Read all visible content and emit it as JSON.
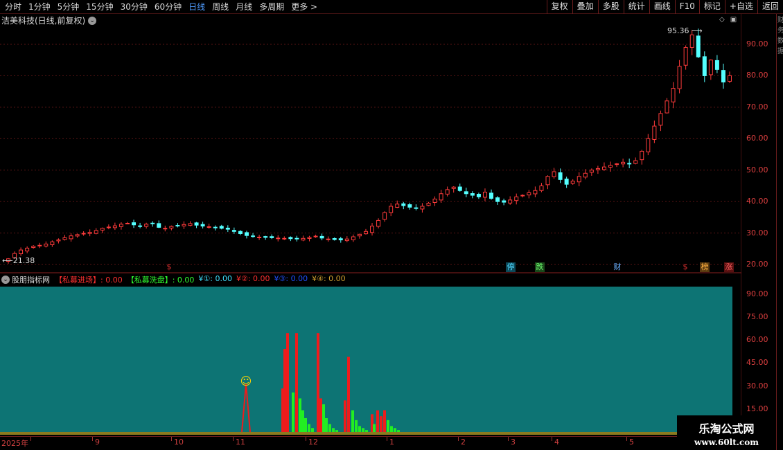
{
  "toolbar": {
    "periods": [
      "分时",
      "1分钟",
      "5分钟",
      "15分钟",
      "30分钟",
      "60分钟",
      "日线",
      "周线",
      "月线",
      "多周期",
      "更多 >"
    ],
    "active_period": "日线",
    "tools": [
      "复权",
      "叠加",
      "多股",
      "统计",
      "画线",
      "F10",
      "标记",
      "+自选",
      "返回"
    ]
  },
  "main": {
    "title": "洁美科技(日线,前复权)",
    "high_label": "95.36",
    "low_label": "21.38",
    "y_ticks": [
      "90.00",
      "80.00",
      "70.00",
      "60.00",
      "50.00",
      "40.00",
      "30.00",
      "20.00"
    ],
    "markers": [
      {
        "text": "$",
        "color": "#e03030",
        "bg": "transparent"
      },
      {
        "text": "停",
        "color": "#4fd8ff",
        "bg": "#0d4a5a"
      },
      {
        "text": "跌",
        "color": "#70ff70",
        "bg": "#1a4a1a"
      },
      {
        "text": "财",
        "color": "#6ab0ff",
        "bg": "transparent"
      },
      {
        "text": "$",
        "color": "#e03030",
        "bg": "transparent"
      },
      {
        "text": "榜",
        "color": "#ffb040",
        "bg": "#5a3a10"
      },
      {
        "text": "涨",
        "color": "#ff6060",
        "bg": "#5a1010"
      }
    ]
  },
  "indicator": {
    "name": "股朋指标网",
    "items": [
      {
        "label": "【私募进场】: 0.00",
        "color": "#ff3030"
      },
      {
        "label": "【私募洗盘】: 0.00",
        "color": "#30ff30"
      },
      {
        "label": "¥①: 0.00",
        "color": "#40e0ff"
      },
      {
        "label": "¥②: 0.00",
        "color": "#ff3030"
      },
      {
        "label": "¥③: 0.00",
        "color": "#2050ff"
      },
      {
        "label": "¥④: 0.00",
        "color": "#d0a030"
      }
    ],
    "y_ticks": [
      "90.00",
      "75.00",
      "60.00",
      "45.00",
      "30.00",
      "15.00"
    ],
    "background": "#0d7474",
    "smiley": "☺"
  },
  "timeline": {
    "labels": [
      "2025年",
      "9",
      "10",
      "11",
      "12",
      "1",
      "2",
      "3",
      "4",
      "5"
    ]
  },
  "watermark": {
    "title": "乐淘公式网",
    "url": "www.60lt.com"
  },
  "right_strip_text": "财务数据",
  "chart_data": {
    "type": "candlestick",
    "title": "洁美科技(日线,前复权)",
    "ylim": [
      18,
      100
    ],
    "y_ticks": [
      20,
      30,
      40,
      50,
      60,
      70,
      80,
      90
    ],
    "high": 95.36,
    "low": 21.38,
    "x_labels": [
      "2025年",
      "9",
      "10",
      "11",
      "12",
      "1",
      "2",
      "3",
      "4",
      "5"
    ],
    "close_values": [
      21.8,
      23.5,
      24.6,
      25.2,
      25.8,
      26.1,
      26.5,
      27.2,
      27.8,
      28.5,
      29.1,
      29.5,
      29.9,
      30.2,
      30.8,
      31.5,
      31.9,
      32.3,
      32.8,
      33.1,
      32.6,
      32.2,
      32.8,
      33.0,
      31.8,
      31.5,
      32.1,
      32.4,
      32.7,
      33.0,
      32.5,
      32.2,
      32.0,
      31.8,
      31.5,
      31.2,
      30.5,
      29.8,
      29.2,
      28.9,
      28.7,
      28.6,
      28.5,
      28.4,
      28.3,
      28.2,
      28.1,
      28.3,
      28.6,
      29.0,
      28.4,
      28.1,
      27.9,
      27.8,
      28.1,
      28.8,
      29.6,
      30.5,
      32.2,
      34.0,
      36.5,
      38.5,
      39.2,
      38.7,
      38.2,
      37.9,
      38.5,
      39.5,
      40.8,
      42.5,
      43.8,
      44.6,
      43.5,
      42.5,
      42.0,
      41.5,
      43.0,
      41.0,
      40.0,
      39.8,
      40.5,
      41.5,
      42.0,
      42.8,
      43.5,
      45.0,
      48.0,
      49.5,
      47.0,
      45.5,
      46.5,
      48.0,
      49.0,
      50.0,
      50.5,
      51.0,
      51.5,
      52.0,
      52.5,
      52.0,
      53.0,
      56.0,
      60.0,
      64.0,
      68.0,
      72.0,
      76.0,
      83.0,
      89.0,
      93.0,
      86.0,
      80.0,
      85.0,
      82.0,
      78.0,
      80.0
    ],
    "indicator_series": [
      {
        "name": "私募进场",
        "type": "bar",
        "color": "red",
        "values": [
          [
            408,
            22
          ],
          [
            411,
            42
          ],
          [
            415,
            50
          ],
          [
            428,
            50
          ],
          [
            459,
            50
          ],
          [
            463,
            17
          ],
          [
            498,
            16
          ],
          [
            503,
            38
          ],
          [
            537,
            9
          ],
          [
            545,
            11
          ],
          [
            550,
            8
          ],
          [
            555,
            11
          ]
        ]
      },
      {
        "name": "私募洗盘",
        "type": "bar",
        "color": "green",
        "values": [
          [
            423,
            20
          ],
          [
            433,
            17
          ],
          [
            437,
            11
          ],
          [
            441,
            7
          ],
          [
            446,
            4
          ],
          [
            451,
            2
          ],
          [
            467,
            14
          ],
          [
            471,
            7
          ],
          [
            476,
            4
          ],
          [
            481,
            2
          ],
          [
            486,
            1
          ],
          [
            509,
            11
          ],
          [
            514,
            6
          ],
          [
            519,
            3
          ],
          [
            524,
            2
          ],
          [
            529,
            1
          ],
          [
            540,
            4
          ],
          [
            560,
            6
          ],
          [
            565,
            3
          ],
          [
            570,
            2
          ],
          [
            575,
            1
          ]
        ]
      }
    ]
  }
}
